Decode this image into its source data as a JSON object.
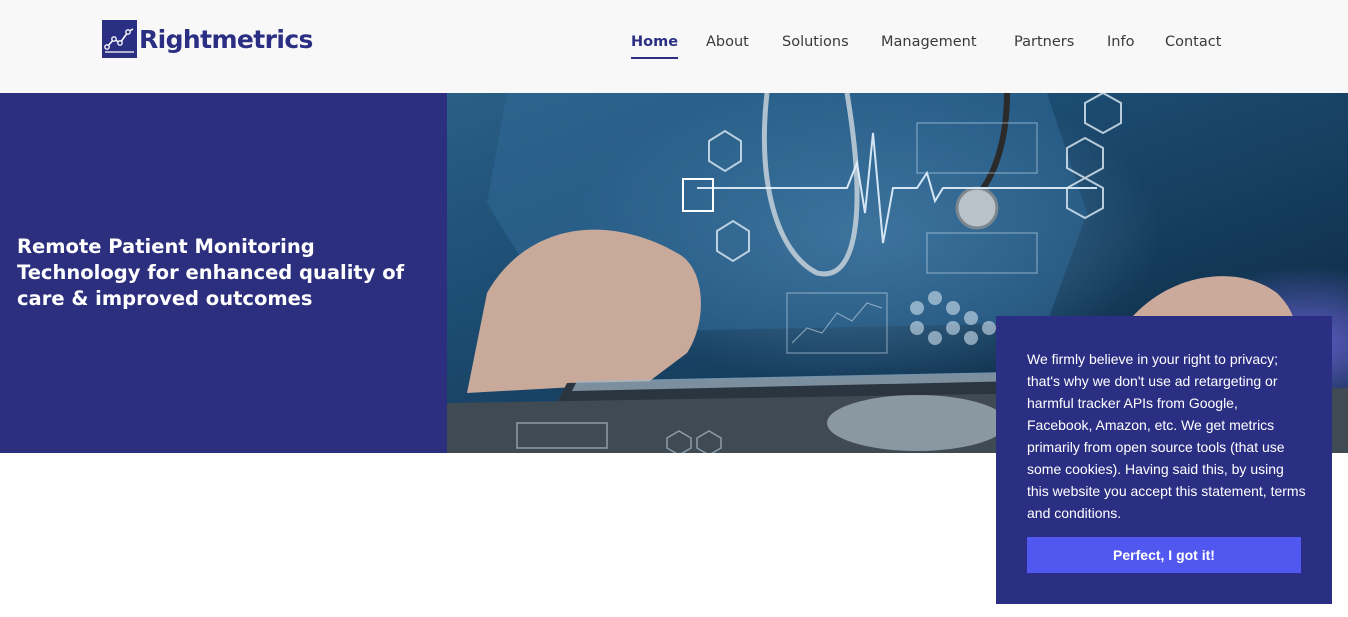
{
  "brand": {
    "name": "Rightmetrics",
    "logo_icon": "chart-line-icon",
    "color": "#2b2f83"
  },
  "nav": {
    "items": [
      {
        "label": "Home",
        "active": true
      },
      {
        "label": "About",
        "active": false
      },
      {
        "label": "Solutions",
        "active": false
      },
      {
        "label": "Management",
        "active": false
      },
      {
        "label": "Partners",
        "active": false
      },
      {
        "label": "Info",
        "active": false
      },
      {
        "label": "Contact",
        "active": false
      }
    ]
  },
  "hero": {
    "title": "Remote Patient Monitoring Technology for enhanced quality of care & improved outcomes",
    "image": "doctor-with-stethoscope-using-tablet-with-medical-holograms",
    "panel_color": "#2b2f7e"
  },
  "cookie_banner": {
    "text": "We firmly believe in your right to privacy; that's why we don't use ad retargeting or harmful tracker APIs from Google, Facebook, Amazon, etc. We get metrics primarily from open source tools (that use some cookies). Having said this, by using this website you accept this statement, terms and conditions.",
    "button_label": "Perfect, I got it!",
    "background": "#2b2f83",
    "button_color": "#5158f0"
  }
}
